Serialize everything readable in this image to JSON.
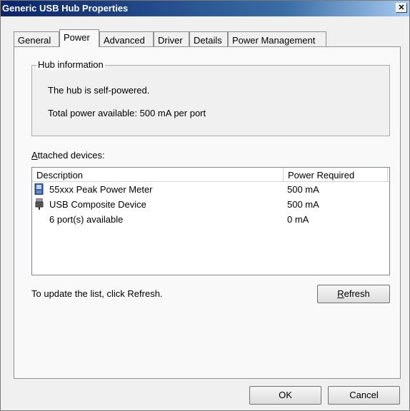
{
  "window": {
    "title": "Generic USB Hub Properties",
    "close_symbol": "✕"
  },
  "tabs": [
    {
      "label": "General"
    },
    {
      "label": "Power"
    },
    {
      "label": "Advanced"
    },
    {
      "label": "Driver"
    },
    {
      "label": "Details"
    },
    {
      "label": "Power Management"
    }
  ],
  "hub_info": {
    "legend": "Hub information",
    "line1": "The hub is self-powered.",
    "line2": "Total power available:  500 mA per port"
  },
  "attached": {
    "label_access_key": "A",
    "label_rest": "ttached devices:",
    "columns": {
      "description": "Description",
      "power": "Power Required"
    },
    "rows": [
      {
        "icon": "power-meter-icon",
        "description": "55xxx Peak Power Meter",
        "power": "500 mA"
      },
      {
        "icon": "usb-plug-icon",
        "description": "USB Composite Device",
        "power": "500 mA"
      },
      {
        "icon": "",
        "description": "6 port(s) available",
        "power": "0 mA"
      }
    ]
  },
  "hint": "To update the list, click Refresh.",
  "buttons": {
    "refresh_access_key": "R",
    "refresh_rest": "efresh",
    "ok": "OK",
    "cancel": "Cancel"
  }
}
